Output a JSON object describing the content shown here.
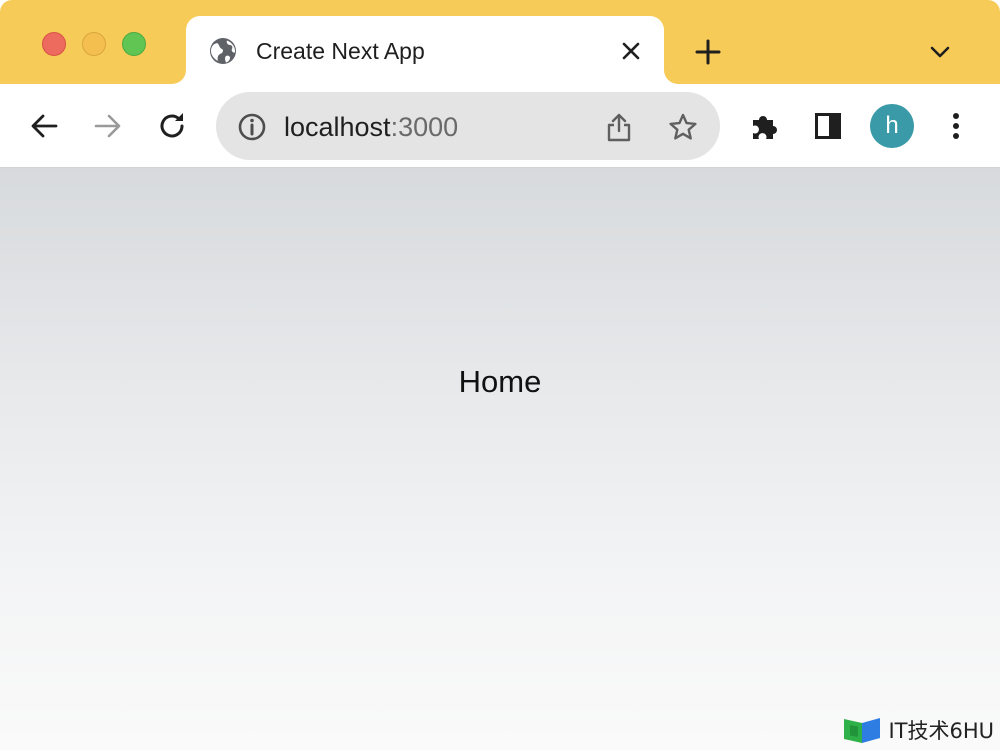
{
  "browser": {
    "tab": {
      "title": "Create Next App",
      "favicon": "globe-icon",
      "close_icon": "close-icon"
    },
    "new_tab_icon": "plus-icon",
    "tab_search_icon": "chevron-down-icon",
    "toolbar": {
      "back_icon": "arrow-left-icon",
      "forward_icon": "arrow-right-icon",
      "reload_icon": "reload-icon",
      "extensions_icon": "puzzle-icon",
      "side_panel_icon": "side-panel-icon",
      "menu_icon": "kebab-menu-icon"
    },
    "omnibox": {
      "info_icon": "info-icon",
      "host": "localhost",
      "port": ":3000",
      "share_icon": "share-icon",
      "bookmark_icon": "star-icon"
    },
    "profile": {
      "initial": "h",
      "color": "#3a9aa8"
    },
    "colors": {
      "tabstrip": "#f7cb57",
      "close_red": "#ed6a5e",
      "minimize_yellow": "#f4bf4f",
      "zoom_green": "#61c554"
    }
  },
  "page": {
    "heading": "Home"
  },
  "watermark": {
    "text": "IT技术6HU"
  }
}
